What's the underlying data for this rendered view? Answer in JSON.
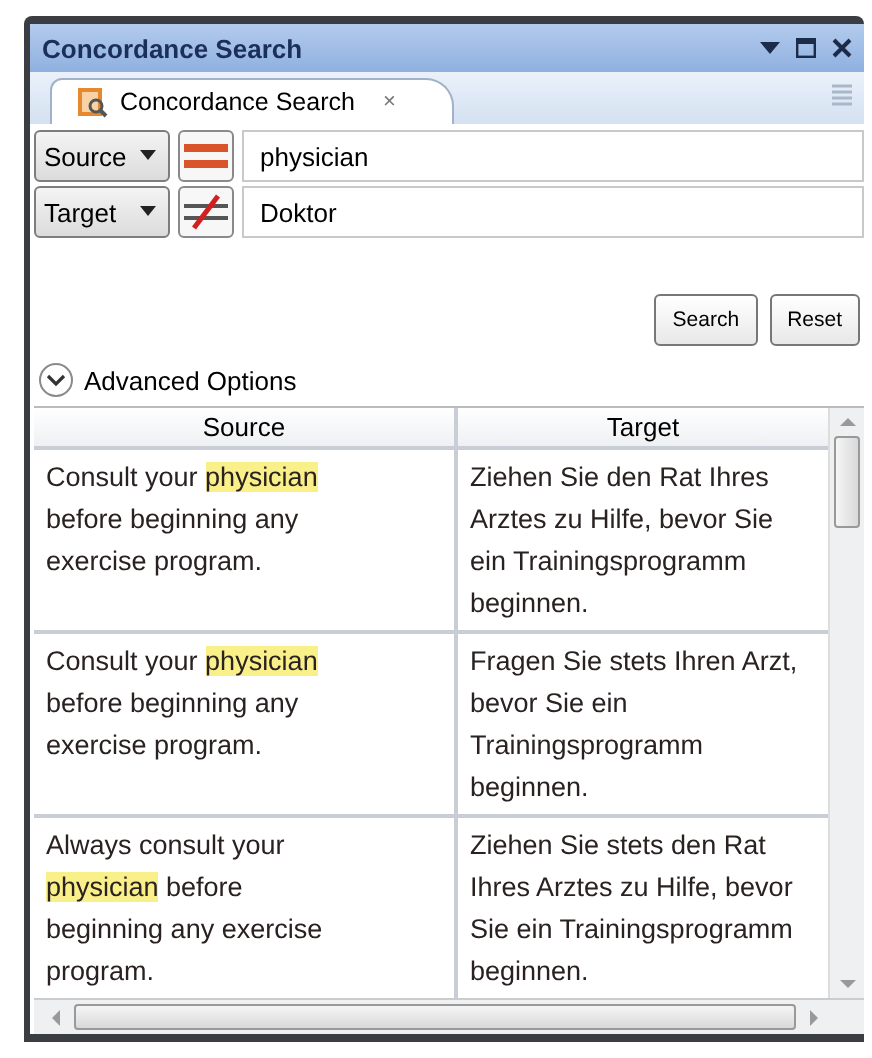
{
  "window": {
    "title": "Concordance Search"
  },
  "tab": {
    "label": "Concordance Search",
    "close": "×",
    "selected": true
  },
  "filters": [
    {
      "field": "Source",
      "negated": false,
      "value": "physician"
    },
    {
      "field": "Target",
      "negated": true,
      "value": "Doktor"
    }
  ],
  "buttons": [
    "Search",
    "Reset"
  ],
  "advanced": {
    "label": "Advanced Options",
    "expanded": false
  },
  "table": {
    "columns": [
      "Source",
      "Target"
    ],
    "rows": [
      {
        "source": [
          {
            "text": "Consult your "
          },
          {
            "text": "physician",
            "highlight": true
          },
          {
            "text": " before beginning any exercise program."
          }
        ],
        "target": "Ziehen Sie den Rat Ihres Arztes zu Hilfe, bevor Sie ein Trainingsprogramm beginnen."
      },
      {
        "source": [
          {
            "text": "Consult your "
          },
          {
            "text": "physician",
            "highlight": true
          },
          {
            "text": " before beginning any exercise program."
          }
        ],
        "target": "Fragen Sie stets Ihren Arzt, bevor Sie ein Trainingsprogramm beginnen."
      },
      {
        "source": [
          {
            "text": "Always consult your "
          },
          {
            "text": "physician",
            "highlight": true
          },
          {
            "text": " before beginning any exercise program."
          }
        ],
        "target": "Ziehen Sie stets den Rat Ihres Arztes zu Hilfe, bevor Sie ein Trainingsprogramm beginnen."
      }
    ]
  }
}
